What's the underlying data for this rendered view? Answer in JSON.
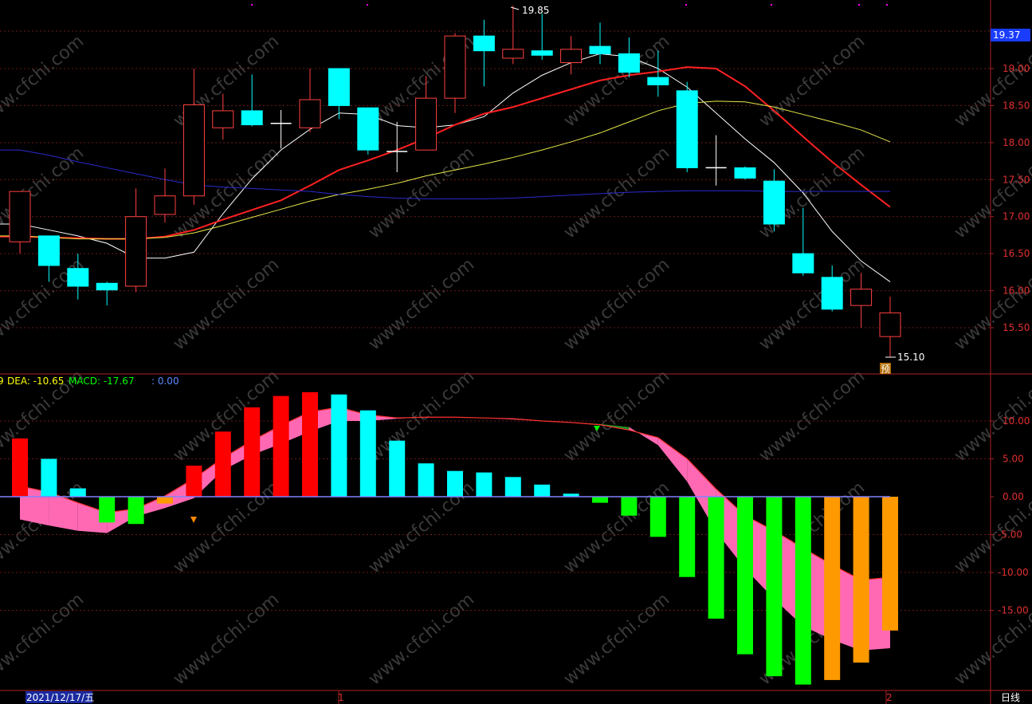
{
  "colors": {
    "background": "#000000",
    "grid": "#6b1a1a",
    "frame": "#b02020",
    "axis_text": "#e03030",
    "up_candle": "#ff4040",
    "down_candle": "#00ffff",
    "ma5": "#ffffff",
    "ma10": "#ff2020",
    "ma20": "#e6e64a",
    "ma60": "#2a2ad0",
    "macd_pos_bar_red": "#ff0000",
    "macd_pos_bar_cyan": "#00ffff",
    "macd_neg_bar_green": "#00ff00",
    "macd_neg_bar_orange": "#ff9900",
    "band_pink": "#ff69b4",
    "band_green": "#228b22",
    "zero_line": "#8080ff",
    "current_price_bg": "#1a3cff"
  },
  "watermark": "www.cfchi.com",
  "price_panel": {
    "current_price": "19.37",
    "high_marker": "19.85",
    "low_marker": "15.10",
    "forecast_badge": "预"
  },
  "macd_panel": {
    "legend": [
      {
        "text": "9",
        "color": "#ffff00"
      },
      {
        "text": "DEA: -10.65",
        "color": "#ffff00"
      },
      {
        "text": "MACD: -17.67",
        "color": "#00ff00"
      },
      {
        "text": ": 0.00",
        "color": "#5b8bff"
      }
    ]
  },
  "bottom_bar": {
    "date_label": "2021/12/17/五",
    "month_markers": [
      "1",
      "2"
    ],
    "period_label": "日线"
  },
  "chart_data": [
    {
      "type": "candlestick",
      "title": "",
      "y_ticks": [
        "19.00",
        "18.50",
        "18.00",
        "17.50",
        "17.00",
        "16.50",
        "16.00",
        "15.50"
      ],
      "ylim": [
        15.0,
        20.0
      ],
      "grid": true,
      "candles": [
        {
          "open": 16.66,
          "high": 17.34,
          "low": 16.5,
          "close": 17.34
        },
        {
          "open": 16.74,
          "high": 16.74,
          "low": 16.12,
          "close": 16.34
        },
        {
          "open": 16.3,
          "high": 16.5,
          "low": 15.88,
          "close": 16.06
        },
        {
          "open": 16.1,
          "high": 16.12,
          "low": 15.8,
          "close": 16.01
        },
        {
          "open": 16.06,
          "high": 17.38,
          "low": 15.98,
          "close": 17.0
        },
        {
          "open": 17.03,
          "high": 17.65,
          "low": 16.92,
          "close": 17.28
        },
        {
          "open": 17.28,
          "high": 19.0,
          "low": 17.16,
          "close": 18.51
        },
        {
          "open": 18.2,
          "high": 18.66,
          "low": 18.04,
          "close": 18.43
        },
        {
          "open": 18.43,
          "high": 18.92,
          "low": 18.22,
          "close": 18.24
        },
        {
          "open": 18.24,
          "high": 18.44,
          "low": 17.92,
          "close": 18.26
        },
        {
          "open": 18.2,
          "high": 19.0,
          "low": 18.14,
          "close": 18.58
        },
        {
          "open": 19.0,
          "high": 19.0,
          "low": 18.32,
          "close": 18.5
        },
        {
          "open": 18.47,
          "high": 18.47,
          "low": 17.84,
          "close": 17.9
        },
        {
          "open": 17.88,
          "high": 18.28,
          "low": 17.6,
          "close": 17.88
        },
        {
          "open": 17.9,
          "high": 18.9,
          "low": 17.9,
          "close": 18.6
        },
        {
          "open": 18.6,
          "high": 19.48,
          "low": 18.4,
          "close": 19.44
        },
        {
          "open": 19.44,
          "high": 19.66,
          "low": 18.76,
          "close": 19.24
        },
        {
          "open": 19.14,
          "high": 19.85,
          "low": 19.06,
          "close": 19.26
        },
        {
          "open": 19.24,
          "high": 19.74,
          "low": 19.12,
          "close": 19.18
        },
        {
          "open": 19.08,
          "high": 19.44,
          "low": 18.92,
          "close": 19.26
        },
        {
          "open": 19.3,
          "high": 19.62,
          "low": 19.06,
          "close": 19.2
        },
        {
          "open": 19.2,
          "high": 19.42,
          "low": 18.88,
          "close": 18.95
        },
        {
          "open": 18.88,
          "high": 19.24,
          "low": 18.62,
          "close": 18.78
        },
        {
          "open": 18.7,
          "high": 18.82,
          "low": 17.6,
          "close": 17.66
        },
        {
          "open": 17.66,
          "high": 18.1,
          "low": 17.42,
          "close": 17.66
        },
        {
          "open": 17.66,
          "high": 17.68,
          "low": 17.5,
          "close": 17.52
        },
        {
          "open": 17.48,
          "high": 17.64,
          "low": 16.8,
          "close": 16.9
        },
        {
          "open": 16.5,
          "high": 17.12,
          "low": 16.2,
          "close": 16.24
        },
        {
          "open": 16.18,
          "high": 16.34,
          "low": 15.72,
          "close": 15.75
        },
        {
          "open": 15.8,
          "high": 16.24,
          "low": 15.5,
          "close": 16.02
        },
        {
          "open": 15.38,
          "high": 15.92,
          "low": 15.1,
          "close": 15.7
        }
      ],
      "ma_lines": [
        {
          "key": "ma5",
          "values": [
            16.9,
            16.82,
            16.74,
            16.64,
            16.44,
            16.44,
            16.52,
            17.04,
            17.51,
            17.9,
            18.18,
            18.4,
            18.38,
            18.23,
            18.2,
            18.24,
            18.35,
            18.67,
            18.91,
            19.08,
            19.2,
            19.16,
            19.0,
            18.75,
            18.4,
            18.05,
            17.73,
            17.32,
            16.8,
            16.4,
            16.12
          ]
        },
        {
          "key": "ma10",
          "values": [
            16.73,
            16.72,
            16.71,
            16.7,
            16.7,
            16.73,
            16.82,
            16.96,
            17.09,
            17.22,
            17.42,
            17.63,
            17.76,
            17.9,
            18.06,
            18.24,
            18.39,
            18.48,
            18.6,
            18.72,
            18.84,
            18.91,
            18.96,
            19.02,
            19.0,
            18.76,
            18.43,
            18.08,
            17.74,
            17.43,
            17.13
          ]
        },
        {
          "key": "ma20",
          "values": [
            16.74,
            16.72,
            16.7,
            16.7,
            16.7,
            16.72,
            16.78,
            16.88,
            16.99,
            17.1,
            17.21,
            17.3,
            17.37,
            17.45,
            17.55,
            17.63,
            17.71,
            17.8,
            17.9,
            18.01,
            18.13,
            18.28,
            18.43,
            18.53,
            18.56,
            18.55,
            18.48,
            18.38,
            18.28,
            18.17,
            18.01
          ]
        },
        {
          "key": "ma60",
          "values": [
            17.9,
            17.83,
            17.74,
            17.66,
            17.58,
            17.5,
            17.43,
            17.4,
            17.38,
            17.36,
            17.34,
            17.3,
            17.27,
            17.25,
            17.24,
            17.24,
            17.24,
            17.25,
            17.27,
            17.29,
            17.31,
            17.33,
            17.34,
            17.35,
            17.35,
            17.35,
            17.34,
            17.34,
            17.34,
            17.34,
            17.34
          ]
        }
      ]
    },
    {
      "type": "bar",
      "title": "",
      "y_ticks": [
        "10.00",
        "5.00",
        "0.00",
        "-5.00",
        "-10.00",
        "-15.00"
      ],
      "ylim": [
        -25.0,
        16.0
      ],
      "grid": true,
      "macd": [
        7.7,
        5.0,
        1.1,
        -3.4,
        -3.6,
        -0.9,
        4.1,
        8.6,
        11.8,
        13.3,
        13.8,
        13.5,
        11.4,
        7.4,
        4.4,
        3.4,
        3.2,
        2.6,
        1.6,
        0.4,
        -0.8,
        -2.5,
        -5.3,
        -10.6,
        -16.1,
        -20.8,
        -23.7,
        -24.8,
        -24.2,
        -21.9,
        -17.67
      ],
      "dea": [
        1.4,
        0.6,
        -0.8,
        -2.1,
        -1.6,
        0.1,
        2.4,
        5.1,
        7.4,
        9.4,
        11.2,
        11.8,
        10.8,
        10.4,
        10.5,
        10.5,
        10.4,
        10.3,
        10.0,
        9.8,
        9.5,
        8.8,
        7.8,
        5.0,
        1.0,
        -2.5,
        -4.5,
        -6.8,
        -9.0,
        -11.0,
        -10.65
      ],
      "dif": [
        -3.0,
        -3.8,
        -4.5,
        -4.8,
        -2.6,
        -1.5,
        -0.2,
        3.5,
        5.5,
        7.0,
        8.6,
        10.0,
        10.0,
        10.3,
        10.5,
        10.5,
        10.4,
        10.2,
        10.0,
        9.8,
        9.6,
        9.2,
        6.8,
        2.0,
        -4.6,
        -9.5,
        -13.5,
        -17.1,
        -18.9,
        -20.3,
        -20.0
      ]
    }
  ]
}
